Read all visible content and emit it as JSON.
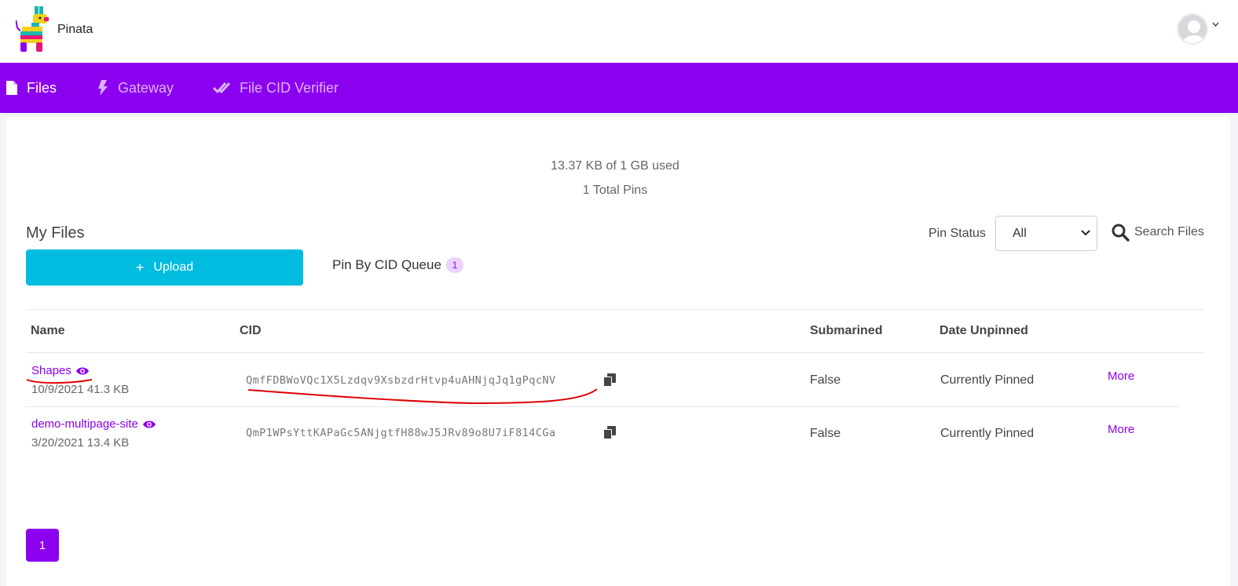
{
  "header": {
    "brand": "Pinata",
    "avatar_icon": "user-avatar-icon"
  },
  "nav": {
    "items": [
      {
        "label": "Files",
        "icon": "file-icon",
        "active": true
      },
      {
        "label": "Gateway",
        "icon": "bolt-icon",
        "active": false
      },
      {
        "label": "File CID Verifier",
        "icon": "double-check-icon",
        "active": false
      }
    ]
  },
  "usage": {
    "storage": "13.37 KB of 1 GB used",
    "total_pins": "1 Total Pins"
  },
  "files": {
    "title": "My Files",
    "upload_label": "Upload",
    "queue_label": "Pin By CID Queue",
    "queue_count": "1",
    "pin_status_label": "Pin Status",
    "pin_status_value": "All",
    "search_label": "Search Files"
  },
  "table": {
    "columns": [
      "Name",
      "CID",
      "Submarined",
      "Date Unpinned"
    ],
    "rows": [
      {
        "name": "Shapes",
        "meta": "10/9/2021 41.3 KB",
        "cid": "QmfFDBWoVQc1X5Lzdqv9XsbzdrHtvp4uAHNjqJq1gPqcNV",
        "submarined": "False",
        "date_unpinned": "Currently Pinned",
        "more": "More"
      },
      {
        "name": "demo-multipage-site",
        "meta": "3/20/2021 13.4 KB",
        "cid": "QmP1WPsYttKAPaGc5ANjgtfH88wJ5JRv89o8U7iF814CGa",
        "submarined": "False",
        "date_unpinned": "Currently Pinned",
        "more": "More"
      }
    ]
  },
  "pagination": {
    "current": "1"
  },
  "colors": {
    "brand_purple": "#8c00f0",
    "upload_cyan": "#00bcdf",
    "annotation_red": "#e00000"
  }
}
